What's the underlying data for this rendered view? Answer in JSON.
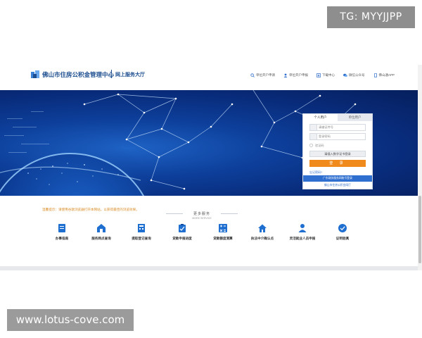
{
  "watermarks": {
    "top_right": "TG: MYYJJPP",
    "bottom_left": "www.lotus-cove.com"
  },
  "header": {
    "site_title": "佛山市住房公积金管理中心",
    "hall_title": "网上服务大厅",
    "links": [
      {
        "label": "单位开户申请",
        "icon": "search-icon"
      },
      {
        "label": "单位开户申报",
        "icon": "user-icon"
      },
      {
        "label": "下载中心",
        "icon": "download-icon"
      },
      {
        "label": "微信公众号",
        "icon": "wechat-icon"
      },
      {
        "label": "佛山通APP",
        "icon": "app-icon"
      }
    ]
  },
  "login": {
    "tabs": [
      "个人用户",
      "单位用户"
    ],
    "active_tab": 0,
    "username_placeholder": "请输证件号",
    "password_placeholder": "登录密码",
    "captcha_placeholder": "验证码",
    "cert_button": "请插入数字证书登录",
    "login_button": "登 录",
    "forgot": "忘记密码?",
    "gd_bar": "广东政务服务网账号登录",
    "pension_bar": "佛山市住房公积金网厅"
  },
  "notice": "温馨提示：请使用谷歌浏览器打开本网站，以获得最佳的浏览效果。",
  "section": {
    "title": "更多服务",
    "subtitle": "MORE SERVICE"
  },
  "services": [
    {
      "label": "办事指南",
      "icon": "guide-icon",
      "color": "#1f6fd1"
    },
    {
      "label": "服务网点查询",
      "icon": "outlet-icon",
      "color": "#1f6fd1"
    },
    {
      "label": "提取登记查询",
      "icon": "withdraw-icon",
      "color": "#1f6fd1"
    },
    {
      "label": "贷款申报进度",
      "icon": "loan-progress-icon",
      "color": "#1f6fd1"
    },
    {
      "label": "贷款额度测算",
      "icon": "calculator-icon",
      "color": "#1f6fd1"
    },
    {
      "label": "执法中介确认点",
      "icon": "house-icon",
      "color": "#1f6fd1"
    },
    {
      "label": "灵活就业人员申报",
      "icon": "person-icon",
      "color": "#1f6fd1"
    },
    {
      "label": "证明验真",
      "icon": "verify-icon",
      "color": "#1f6fd1"
    }
  ],
  "colors": {
    "brand_blue": "#1d4e8f",
    "banner_blue": "#0d3f9b",
    "login_orange": "#f08a1c",
    "notice_orange": "#d98b25"
  }
}
